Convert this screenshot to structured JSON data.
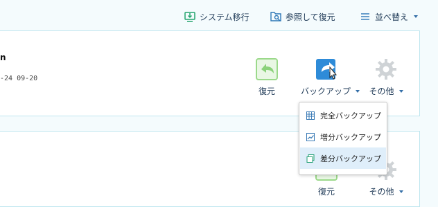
{
  "toolbar": {
    "system_migration": {
      "label": "システム移行",
      "icon": "migration-icon"
    },
    "browse_restore": {
      "label": "参照して復元",
      "icon": "browse-restore-icon"
    },
    "sort": {
      "label": "並べ替え",
      "icon": "sort-icon"
    }
  },
  "cards": [
    {
      "name_fragment": "n",
      "date_fragment": "-24 09-20",
      "actions": {
        "restore": {
          "label": "復元",
          "icon": "restore-icon"
        },
        "backup": {
          "label": "バックアップ",
          "icon": "backup-icon"
        },
        "other": {
          "label": "その他",
          "icon": "gear-icon"
        }
      }
    },
    {
      "actions": {
        "restore": {
          "label": "復元",
          "icon": "restore-icon"
        },
        "other": {
          "label": "その他",
          "icon": "gear-icon"
        }
      }
    }
  ],
  "backup_menu": {
    "items": [
      {
        "label": "完全バックアップ",
        "icon": "calendar-icon"
      },
      {
        "label": "増分バックアップ",
        "icon": "trend-chart-icon"
      },
      {
        "label": "差分バックアップ",
        "icon": "copy-icon"
      }
    ],
    "highlighted_index": 2
  },
  "colors": {
    "accent_blue": "#2e8bd8",
    "restore_green": "#8bd27a",
    "gear_gray": "#cfd3d6",
    "toolbar_icon_green": "#22a36c"
  }
}
